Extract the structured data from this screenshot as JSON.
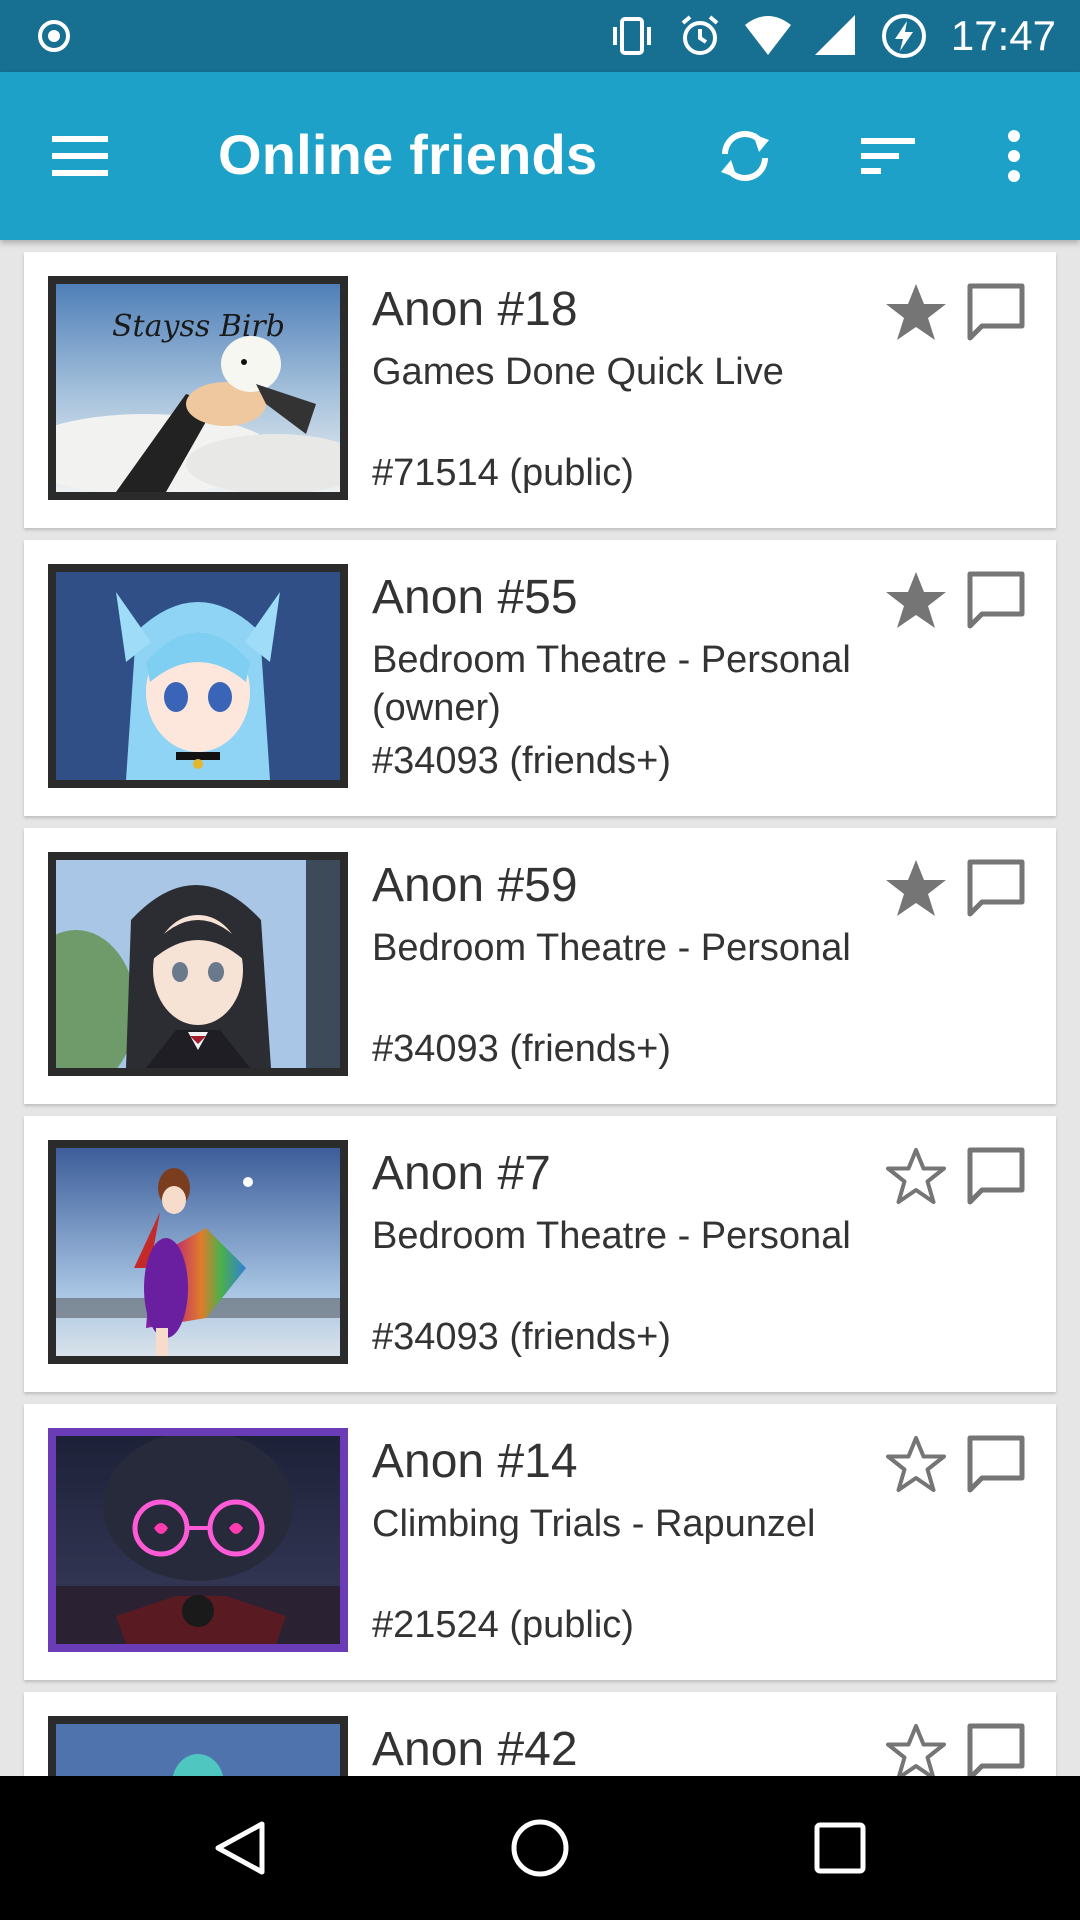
{
  "status_bar": {
    "time": "17:47",
    "icons": [
      "record-icon",
      "vibrate-icon",
      "alarm-icon",
      "wifi-icon",
      "cell-signal-icon",
      "battery-charging-icon"
    ]
  },
  "app_bar": {
    "title": "Online friends",
    "icons": [
      "menu-icon",
      "refresh-icon",
      "sort-icon",
      "more-vert-icon"
    ]
  },
  "friends": [
    {
      "name": "Anon #18",
      "world": "Games Done Quick Live",
      "instance": "#71514 (public)",
      "favorited": true
    },
    {
      "name": "Anon #55",
      "world": "Bedroom Theatre - Personal (owner)",
      "instance": "#34093 (friends+)",
      "favorited": true
    },
    {
      "name": "Anon #59",
      "world": "Bedroom Theatre - Personal",
      "instance": "#34093 (friends+)",
      "favorited": true
    },
    {
      "name": "Anon #7",
      "world": "Bedroom Theatre - Personal",
      "instance": "#34093 (friends+)",
      "favorited": false
    },
    {
      "name": "Anon #14",
      "world": "Climbing Trials - Rapunzel",
      "instance": "#21524 (public)",
      "favorited": false
    },
    {
      "name": "Anon #42",
      "favorited": false
    }
  ],
  "thumbnails": {
    "0": {
      "caption": "Stayss Birb"
    }
  },
  "colors": {
    "status_bar": "#176f92",
    "app_bar": "#1ea1c9",
    "icon_gray": "#757575"
  },
  "nav_bar": {
    "icons": [
      "back-icon",
      "home-icon",
      "recents-icon"
    ]
  }
}
